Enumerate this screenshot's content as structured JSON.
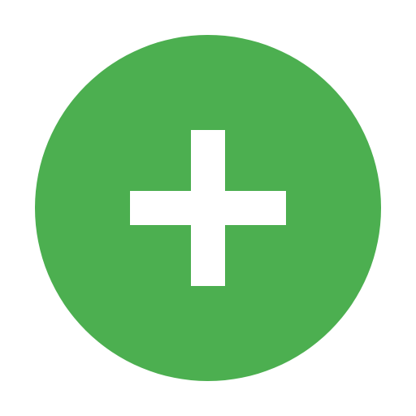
{
  "icon": {
    "name": "plus-icon",
    "shape": "circle",
    "background_color": "#4caf50",
    "glyph_color": "#ffffff"
  },
  "page": {
    "background_color": "#ffffff"
  }
}
